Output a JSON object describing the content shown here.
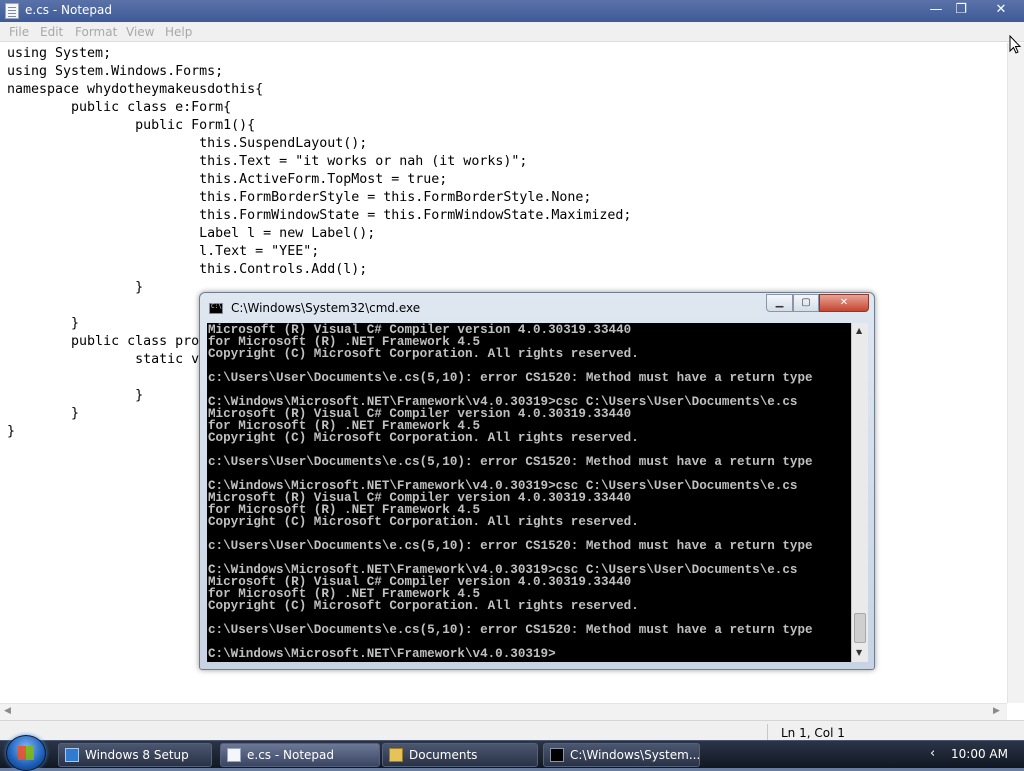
{
  "notepad": {
    "title": "e.cs - Notepad",
    "controls": {
      "minimize": "—",
      "maximize": "❐",
      "close": "✕"
    },
    "menu": [
      "File",
      "Edit",
      "Format",
      "View",
      "Help"
    ],
    "code": "using System;\nusing System.Windows.Forms;\nnamespace whydotheymakeusdothis{\n        public class e:Form{\n                public Form1(){\n                        this.SuspendLayout();\n                        this.Text = \"it works or nah (it works)\";\n                        this.ActiveForm.TopMost = true;\n                        this.FormBorderStyle = this.FormBorderStyle.None;\n                        this.FormWindowState = this.FormWindowState.Maximized;\n                        Label l = new Label();\n                        l.Text = \"YEE\";\n                        this.Controls.Add(l);\n                }\n\n        }\n        public class prog\n                static vo\n\n                }\n        }\n}",
    "status_position": "Ln 1, Col 1"
  },
  "cmd": {
    "title": "C:\\Windows\\System32\\cmd.exe",
    "controls": {
      "minimize": "▁",
      "maximize": "▢",
      "close": "✕"
    },
    "output": "Microsoft (R) Visual C# Compiler version 4.0.30319.33440\nfor Microsoft (R) .NET Framework 4.5\nCopyright (C) Microsoft Corporation. All rights reserved.\n\nc:\\Users\\User\\Documents\\e.cs(5,10): error CS1520: Method must have a return type\n\nC:\\Windows\\Microsoft.NET\\Framework\\v4.0.30319>csc C:\\Users\\User\\Documents\\e.cs\nMicrosoft (R) Visual C# Compiler version 4.0.30319.33440\nfor Microsoft (R) .NET Framework 4.5\nCopyright (C) Microsoft Corporation. All rights reserved.\n\nc:\\Users\\User\\Documents\\e.cs(5,10): error CS1520: Method must have a return type\n\nC:\\Windows\\Microsoft.NET\\Framework\\v4.0.30319>csc C:\\Users\\User\\Documents\\e.cs\nMicrosoft (R) Visual C# Compiler version 4.0.30319.33440\nfor Microsoft (R) .NET Framework 4.5\nCopyright (C) Microsoft Corporation. All rights reserved.\n\nc:\\Users\\User\\Documents\\e.cs(5,10): error CS1520: Method must have a return type\n\nC:\\Windows\\Microsoft.NET\\Framework\\v4.0.30319>csc C:\\Users\\User\\Documents\\e.cs\nMicrosoft (R) Visual C# Compiler version 4.0.30319.33440\nfor Microsoft (R) .NET Framework 4.5\nCopyright (C) Microsoft Corporation. All rights reserved.\n\nc:\\Users\\User\\Documents\\e.cs(5,10): error CS1520: Method must have a return type\n\nC:\\Windows\\Microsoft.NET\\Framework\\v4.0.30319>"
  },
  "taskbar": {
    "items": [
      "Windows 8 Setup",
      "e.cs - Notepad",
      "Documents",
      "C:\\Windows\\System..."
    ],
    "tray_chevron": "‹",
    "clock": "10:00 AM"
  },
  "icons": {
    "notepad_app": "notepad-icon",
    "cmd_app": "console-icon",
    "start": "windows-start-icon",
    "setup": "setup-icon",
    "documents": "folder-icon",
    "cursor": "mouse-pointer-icon"
  },
  "colors": {
    "titlebar": "#4a64a0",
    "console_bg": "#000000",
    "console_fg": "#c0c0c0",
    "close_red": "#c54530"
  }
}
